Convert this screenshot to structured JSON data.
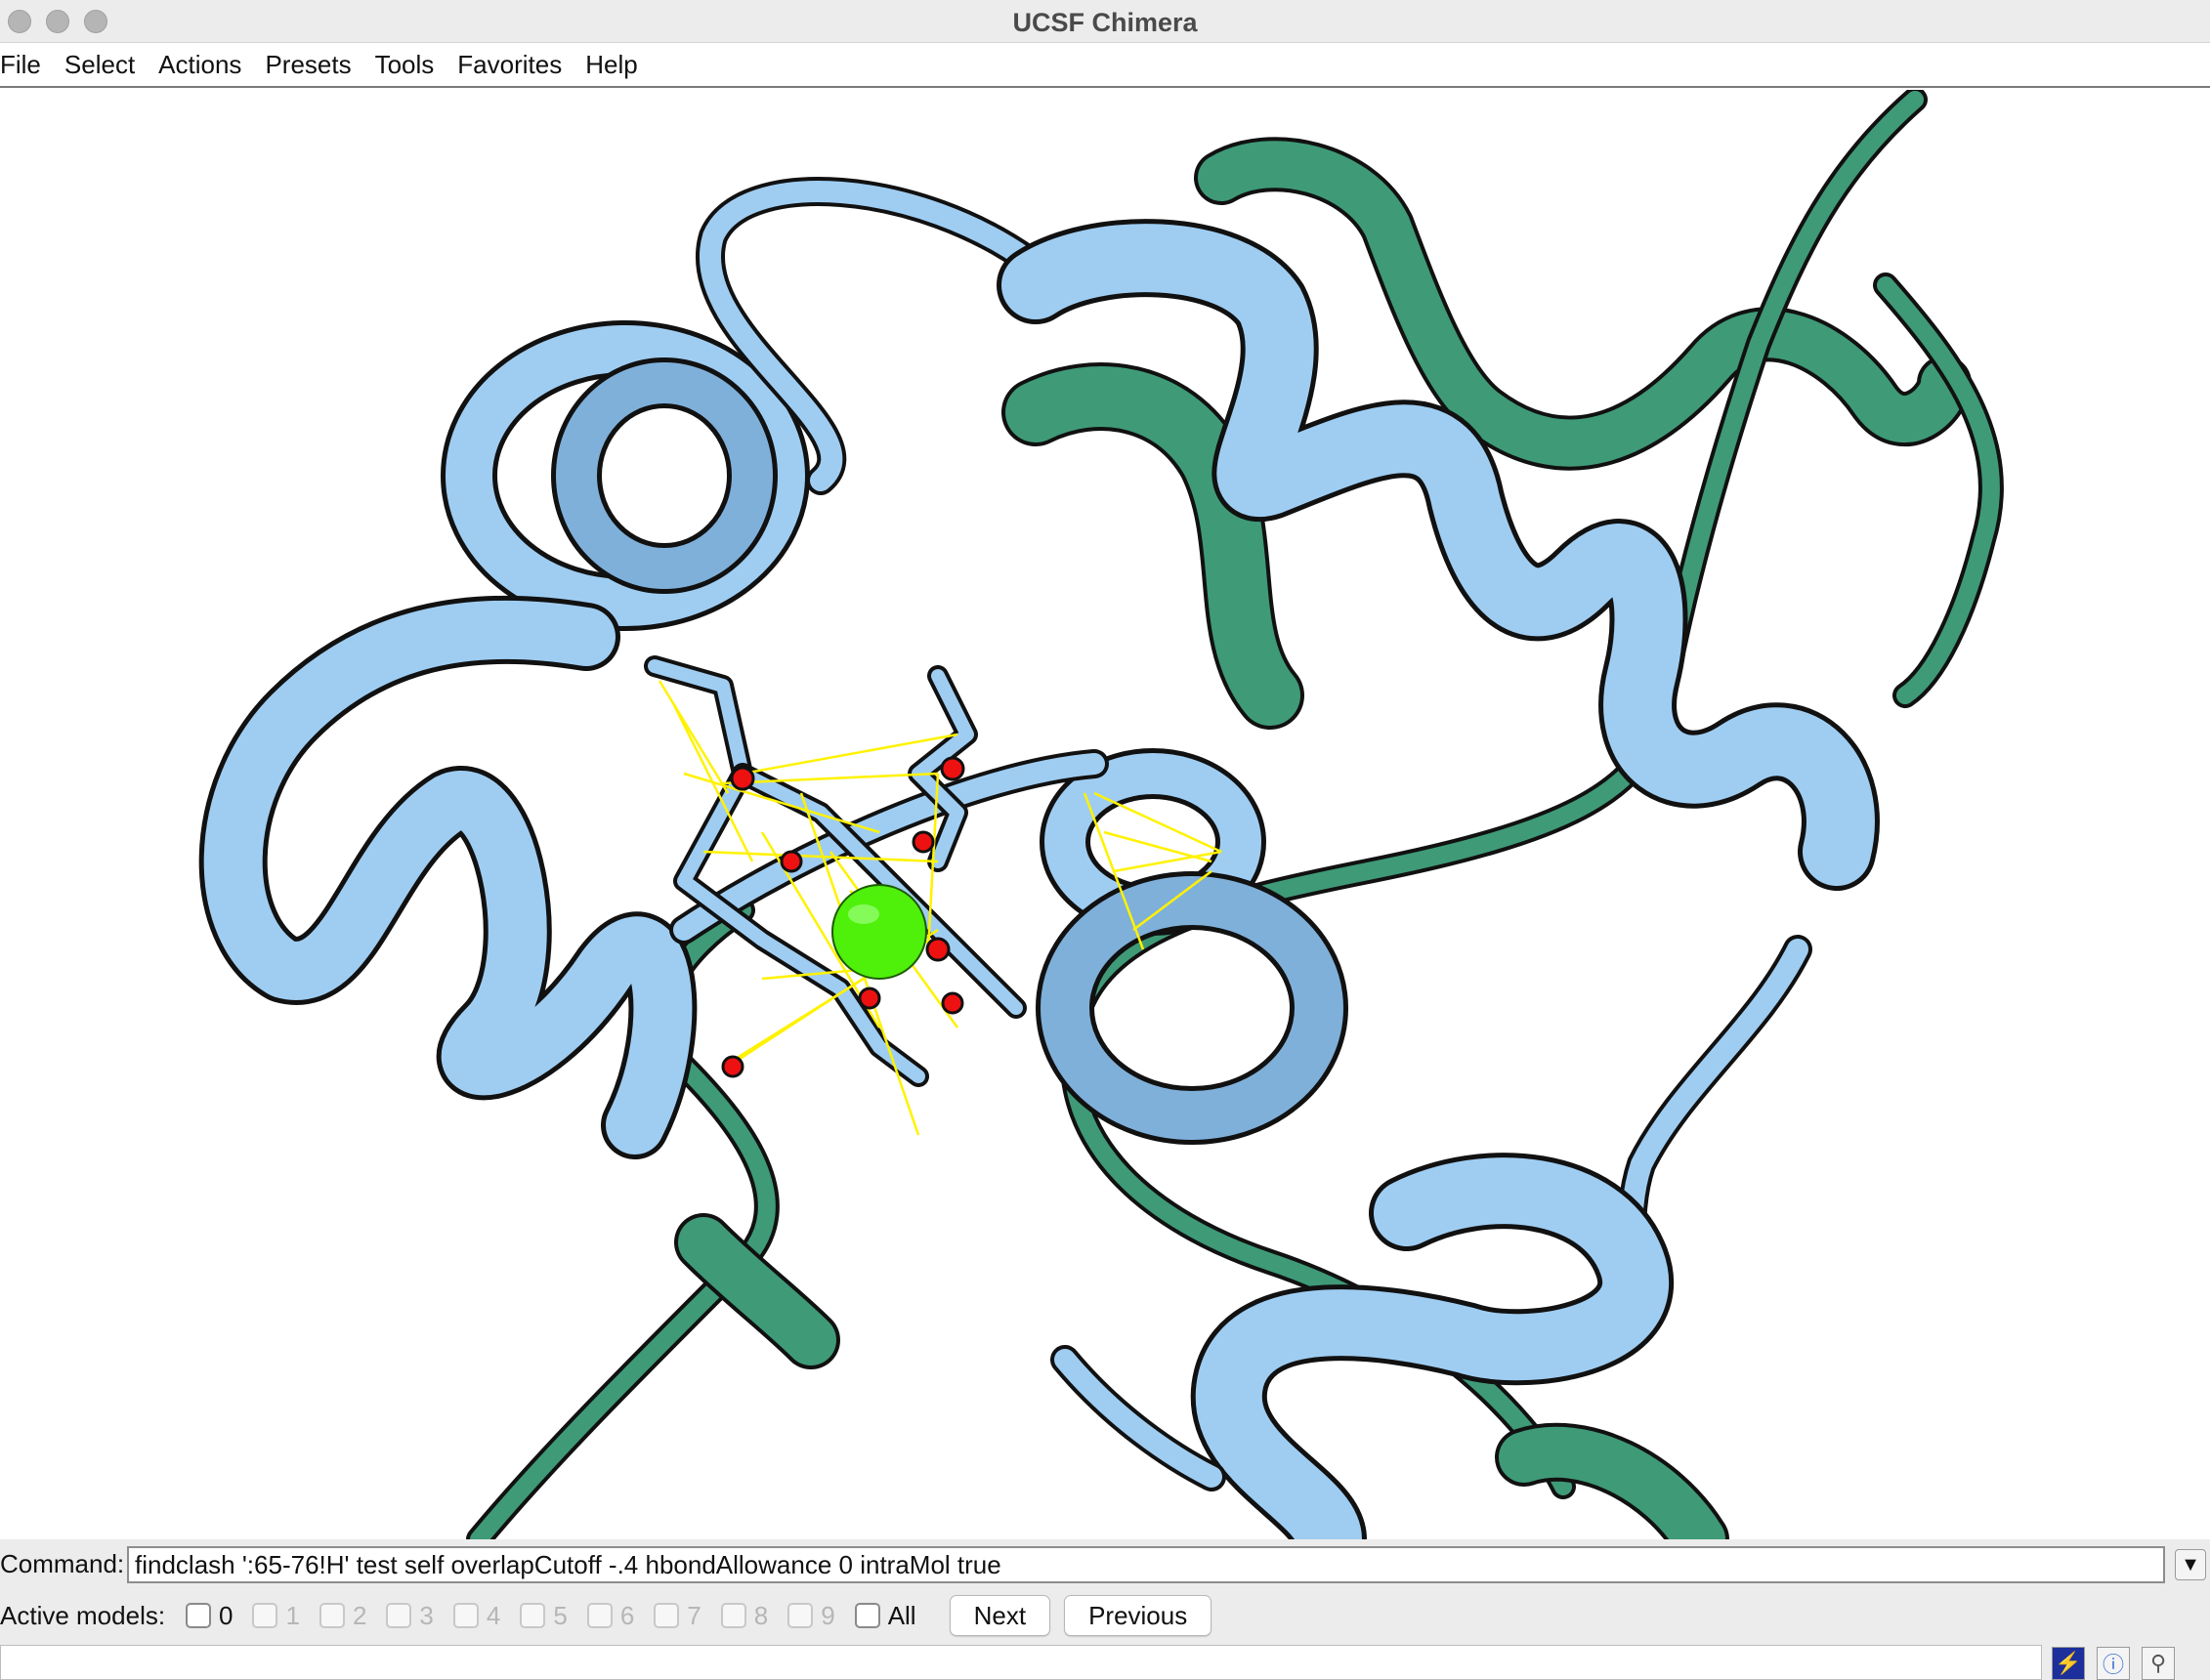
{
  "window": {
    "title": "UCSF Chimera"
  },
  "menubar": {
    "items": [
      {
        "label": "File"
      },
      {
        "label": "Select"
      },
      {
        "label": "Actions"
      },
      {
        "label": "Presets"
      },
      {
        "label": "Tools"
      },
      {
        "label": "Favorites"
      },
      {
        "label": "Help"
      }
    ]
  },
  "viewer": {
    "description_colors": {
      "chain_a": "#9fcdf2",
      "chain_b": "#3f9a78",
      "ion": "#4ff00a",
      "contacts": "#fff200",
      "oxygen": "#ee1111"
    }
  },
  "command": {
    "label": "Command:",
    "value": "findclash ':65-76!H' test self overlapCutoff -.4 hbondAllowance 0 intraMol true"
  },
  "models": {
    "label": "Active models:",
    "boxes": [
      {
        "label": "0",
        "checked": true,
        "enabled": true
      },
      {
        "label": "1",
        "checked": false,
        "enabled": false
      },
      {
        "label": "2",
        "checked": false,
        "enabled": false
      },
      {
        "label": "3",
        "checked": false,
        "enabled": false
      },
      {
        "label": "4",
        "checked": false,
        "enabled": false
      },
      {
        "label": "5",
        "checked": false,
        "enabled": false
      },
      {
        "label": "6",
        "checked": false,
        "enabled": false
      },
      {
        "label": "7",
        "checked": false,
        "enabled": false
      },
      {
        "label": "8",
        "checked": false,
        "enabled": false
      },
      {
        "label": "9",
        "checked": false,
        "enabled": false
      }
    ],
    "all_label": "All",
    "next_label": "Next",
    "previous_label": "Previous"
  },
  "status": {
    "text": ""
  }
}
